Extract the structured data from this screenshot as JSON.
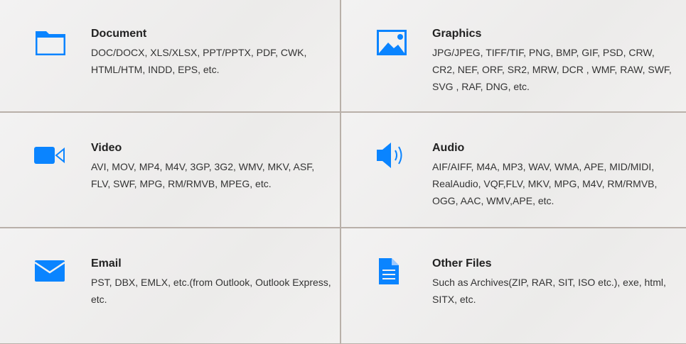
{
  "items": [
    {
      "title": "Document",
      "desc": "DOC/DOCX, XLS/XLSX, PPT/PPTX, PDF, CWK, HTML/HTM, INDD, EPS, etc.",
      "icon": "folder-icon"
    },
    {
      "title": "Graphics",
      "desc": "JPG/JPEG, TIFF/TIF, PNG, BMP, GIF, PSD, CRW, CR2, NEF, ORF, SR2, MRW, DCR , WMF, RAW, SWF, SVG , RAF, DNG, etc.",
      "icon": "image-icon"
    },
    {
      "title": "Video",
      "desc": "AVI, MOV, MP4, M4V, 3GP, 3G2, WMV, MKV, ASF, FLV, SWF, MPG, RM/RMVB, MPEG, etc.",
      "icon": "video-camera-icon"
    },
    {
      "title": "Audio",
      "desc": "AIF/AIFF, M4A, MP3, WAV, WMA, APE, MID/MIDI, RealAudio, VQF,FLV, MKV, MPG, M4V, RM/RMVB, OGG, AAC, WMV,APE, etc.",
      "icon": "speaker-icon"
    },
    {
      "title": "Email",
      "desc": "PST, DBX, EMLX, etc.(from Outlook, Outlook Express, etc.",
      "icon": "envelope-icon"
    },
    {
      "title": "Other Files",
      "desc": "Such as Archives(ZIP, RAR, SIT, ISO etc.), exe, html, SITX, etc.",
      "icon": "file-icon"
    }
  ],
  "accent": "#0a84ff"
}
